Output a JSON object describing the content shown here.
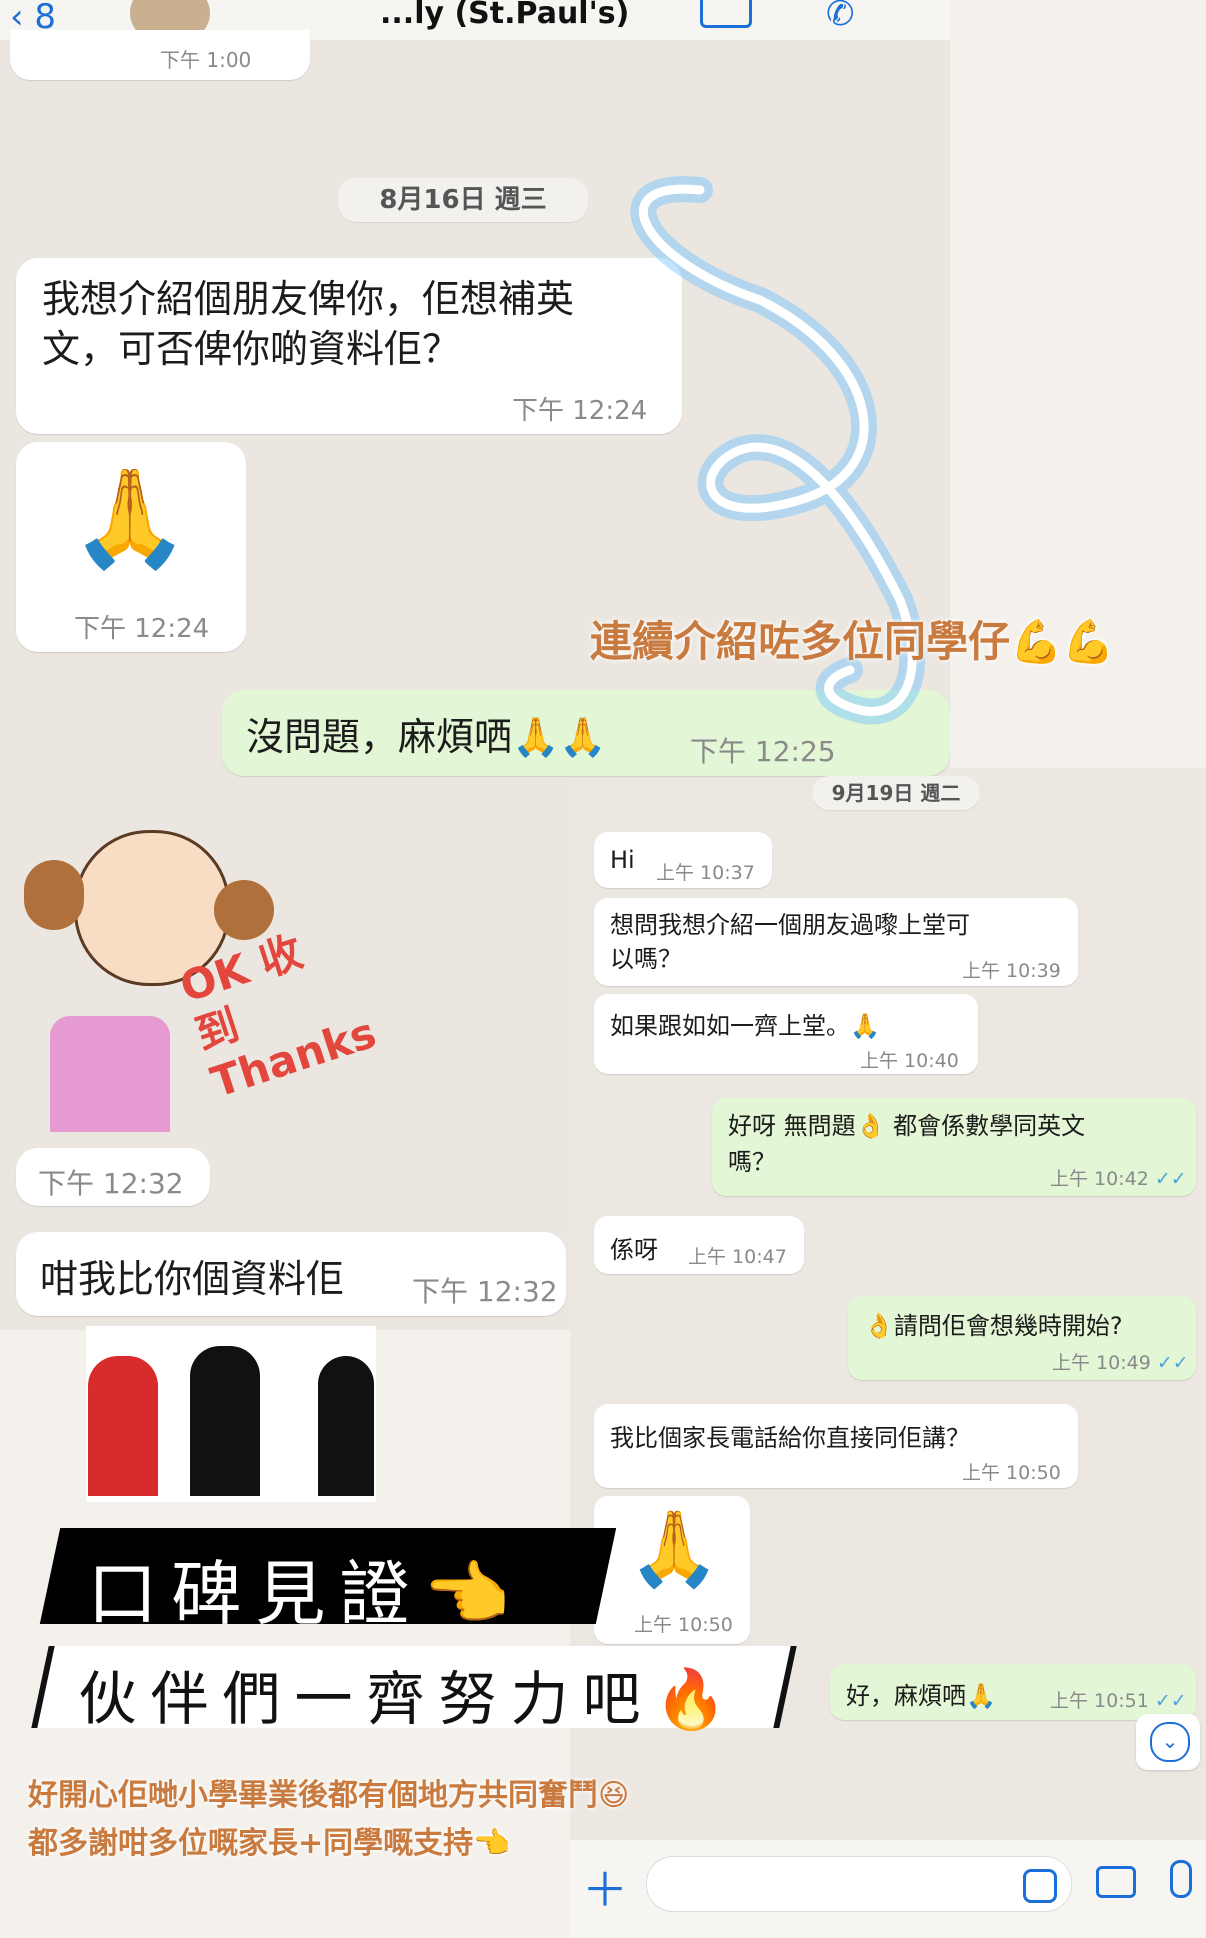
{
  "header": {
    "back_label": "8",
    "title": "...ly (St.Paul's)",
    "video_icon": "video-call-icon",
    "phone_icon": "phone-icon",
    "top_time_partial": "下午 1:00"
  },
  "left_chat": {
    "date_label": "8月16日 週三",
    "messages": [
      {
        "text": "我想介紹個朋友俾你，佢想補英\n文，可否俾你啲資料佢？",
        "time": "下午 12:24"
      },
      {
        "emoji": "🙏",
        "time": "下午 12:24"
      },
      {
        "text": "沒問題，麻煩哂🙏🙏",
        "time": "下午 12:25"
      },
      {
        "sticker": "OK 收到 Thanks",
        "time": "下午 12:32"
      },
      {
        "text": "咁我比你個資料佢",
        "time": "下午 12:32"
      }
    ]
  },
  "right_chat": {
    "date_label": "9月19日 週二",
    "messages": [
      {
        "text": "Hi",
        "time": "上午 10:37"
      },
      {
        "text": "想問我想介紹一個朋友過嚟上堂可\n以嗎？",
        "time": "上午 10:39"
      },
      {
        "text": "如果跟如如一齊上堂。🙏",
        "time": "上午 10:40"
      },
      {
        "text": "好呀 無問題👌 都會係數學同英文\n嗎？",
        "time": "上午 10:42"
      },
      {
        "text": "係呀",
        "time": "上午 10:47"
      },
      {
        "text": "👌請問佢會想幾時開始?",
        "time": "上午 10:49"
      },
      {
        "text": "我比個家長電話給你直接同佢講？",
        "time": "上午 10:50"
      },
      {
        "emoji": "🙏",
        "time": "上午 10:50"
      },
      {
        "text": "好，麻煩哂🙏",
        "time": "上午 10:51"
      }
    ],
    "ticks": "✓✓"
  },
  "overlay": {
    "caption_top": "連續介紹咗多位同學仔💪💪",
    "ribbon1": "口碑見證👈",
    "ribbon2": "伙伴們一齊努力吧🔥",
    "caption_bottom1": "好開心佢哋小學畢業後都有個地方共同奮鬥😆",
    "caption_bottom2": "都多謝咁多位嘅家長+同學嘅支持👈"
  },
  "input_bar": {
    "plus_icon": "＋",
    "sticker_icon": "sticker-icon",
    "camera_icon": "camera-icon",
    "mic_icon": "mic-icon",
    "scroll_down_icon": "chevron-down-icon"
  },
  "colors": {
    "accent": "#1a6fd8",
    "outgoing_bubble": "#e3f6d5",
    "chat_bg": "#ebe6e0",
    "caption": "#c97a3f",
    "neon": "#6fc3ff"
  }
}
